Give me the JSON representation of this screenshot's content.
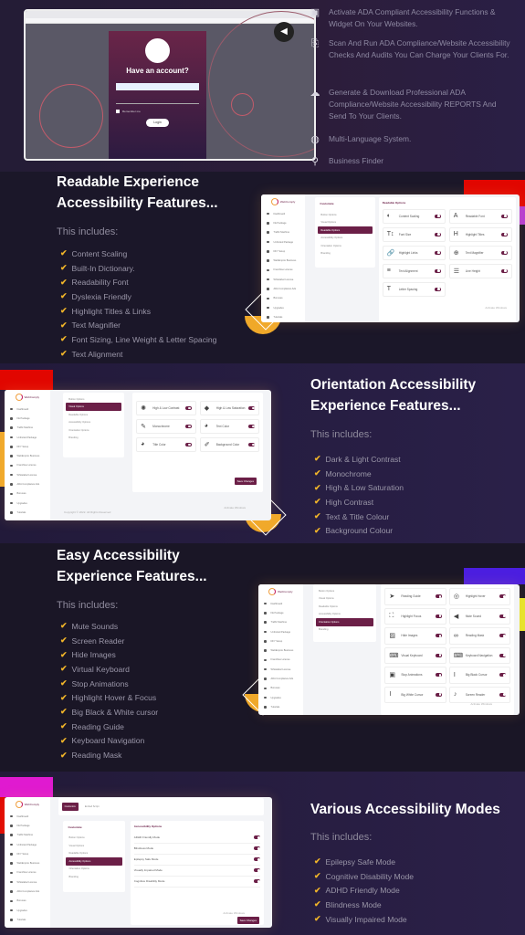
{
  "hero": {
    "login_title": "Have an account?",
    "remember": "Remember me",
    "login_button": "Login",
    "features": [
      {
        "icon": "browser-widget-icon",
        "glyph": "▣",
        "text": "Activate ADA Compliant Accessibility Functions & Widget On Your Websites."
      },
      {
        "icon": "audit-scan-icon",
        "glyph": "⎘",
        "text": "Scan And Run ADA Compliance/Website Accessibility Checks And Audits You Can Charge Your Clients For."
      },
      {
        "icon": "cloud-download-icon",
        "glyph": "☁",
        "text": "Generate & Download Professional ADA Compliance/Website Accessibility REPORTS And Send To Your Clients."
      },
      {
        "icon": "globe-language-icon",
        "glyph": "◍",
        "text": "Multi-Language System."
      },
      {
        "icon": "search-icon",
        "glyph": "⚲",
        "text": "Business Finder"
      }
    ]
  },
  "sections": [
    {
      "heading": [
        "Readable Experience",
        "Accessibility Features..."
      ],
      "includes": "This includes:",
      "items": [
        "Content Scaling",
        "Built-In Dictionary.",
        "Readability Font",
        "Dyslexia Friendly",
        "Highlight Titles & Links",
        "Text Magnifier",
        "Font Sizing, Line Weight & Letter Spacing",
        "Text Alignment"
      ]
    },
    {
      "heading": [
        "Orientation Accessibility",
        "Experience Features..."
      ],
      "includes": "This includes:",
      "items": [
        "Dark & Light Contrast",
        "Monochrome",
        "High & Low Saturation",
        "High Contrast",
        "Text & Title Colour",
        "Background Colour"
      ]
    },
    {
      "heading": [
        "Easy Accessibility",
        "Experience Features..."
      ],
      "includes": "This includes:",
      "items": [
        "Mute Sounds",
        "Screen Reader",
        "Hide Images",
        "Virtual Keyboard",
        "Stop Animations",
        "Highlight Hover & Focus",
        "Big Black & White cursor",
        "Reading Guide",
        "Keyboard Navigation",
        "Reading Mask"
      ]
    },
    {
      "heading": [
        "Various Accessibility Modes"
      ],
      "includes": "This includes:",
      "items": [
        "Epilepsy Safe Mode",
        "Cognitive Disability Mode",
        "ADHD Friendly Mode",
        "Blindness Mode",
        "Visually Impaired Mode"
      ]
    }
  ],
  "mock": {
    "logo": "WebComply",
    "sidebar": [
      "Dashboard",
      "FE Package",
      "Traffic Machine",
      "Unlimited Package",
      "DFY Setup",
      "WebEmpire Business",
      "Franchise License",
      "Whitelabel License",
      "ADA Compliance Ads",
      "Bonuses",
      "Upgrades",
      "Tutorials"
    ],
    "menu_title": "Customize",
    "menu": [
      "Button Options",
      "Visual Options",
      "Readable Options",
      "Accessibility Options",
      "Orientation Options",
      "Branding"
    ],
    "save": "Save Changes",
    "watermark": "Activate Windows",
    "readable": {
      "title": "Readable Options",
      "cards": [
        [
          "◐",
          "Content Scaling"
        ],
        [
          "A",
          "Readable Font"
        ],
        [
          "T↕",
          "Font Size"
        ],
        [
          "H",
          "Highlight Titles"
        ],
        [
          "🔗",
          "Highlight Links"
        ],
        [
          "⊕",
          "Text Magnifier"
        ],
        [
          "≡",
          "Text Alignment"
        ],
        [
          "☰",
          "Line Height"
        ],
        [
          "T",
          "Letter Spacing"
        ]
      ]
    },
    "visual": {
      "cards": [
        [
          "✺",
          "High & Low Contrast"
        ],
        [
          "◆",
          "High & Low Saturation"
        ],
        [
          "✎",
          "Monochrome"
        ],
        [
          "◕",
          "Text Color"
        ],
        [
          "◕",
          "Title Color"
        ],
        [
          "✐",
          "Background Color"
        ]
      ],
      "copyright": "Copyright © 2022. All Rights Reserved"
    },
    "orientation": {
      "cards": [
        [
          "➤",
          "Reading Guide"
        ],
        [
          "◎",
          "Highlight Hover"
        ],
        [
          "⛶",
          "Highlight Focus"
        ],
        [
          "◀",
          "Mute Sound"
        ],
        [
          "▨",
          "Hide Images"
        ],
        [
          "∞",
          "Reading Mask"
        ],
        [
          "⌨",
          "Visual Keyboard"
        ],
        [
          "⌨",
          "Keyboard Navigation"
        ],
        [
          "▣",
          "Stop Animations"
        ],
        [
          "I",
          "Big Black Cursor"
        ],
        [
          "I",
          "Big White Cursor"
        ],
        [
          "♪",
          "Screen Reader"
        ]
      ]
    },
    "accessibility": {
      "tabs": [
        "Customize",
        "Embed Script"
      ],
      "title": "Accessibility Options",
      "rows": [
        "ADHD Friendly Mode",
        "Blindness Mode",
        "Epilepsy Safe Mode",
        "Visually Impaired Mode",
        "Cognitive Disability Mode"
      ]
    }
  },
  "colors": {
    "accent": "#6b1f47",
    "check": "#f0b429"
  }
}
